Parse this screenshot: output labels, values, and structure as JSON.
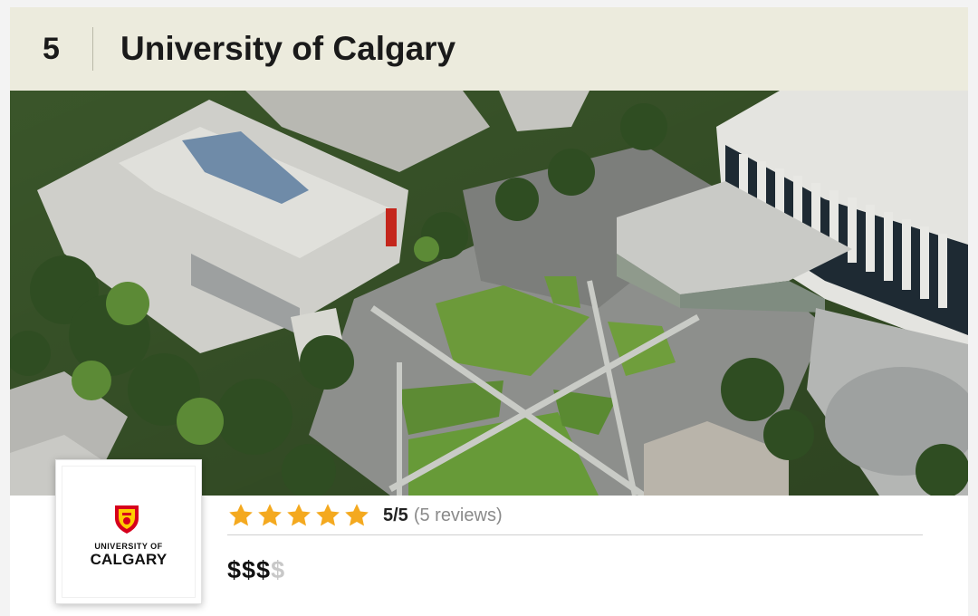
{
  "listing": {
    "rank": "5",
    "title": "University of Calgary"
  },
  "logo": {
    "line1": "UNIVERSITY OF",
    "line2": "CALGARY",
    "crest_colors": [
      "#d6001c",
      "#ffcd00"
    ]
  },
  "rating": {
    "stars_filled": 5,
    "stars_total": 5,
    "score": "5/5",
    "reviews": "(5 reviews)",
    "star_color": "#f4a91f"
  },
  "price": {
    "active": "$$$",
    "inactive": "$"
  },
  "hero": {
    "icon": "aerial-campus-photo"
  }
}
